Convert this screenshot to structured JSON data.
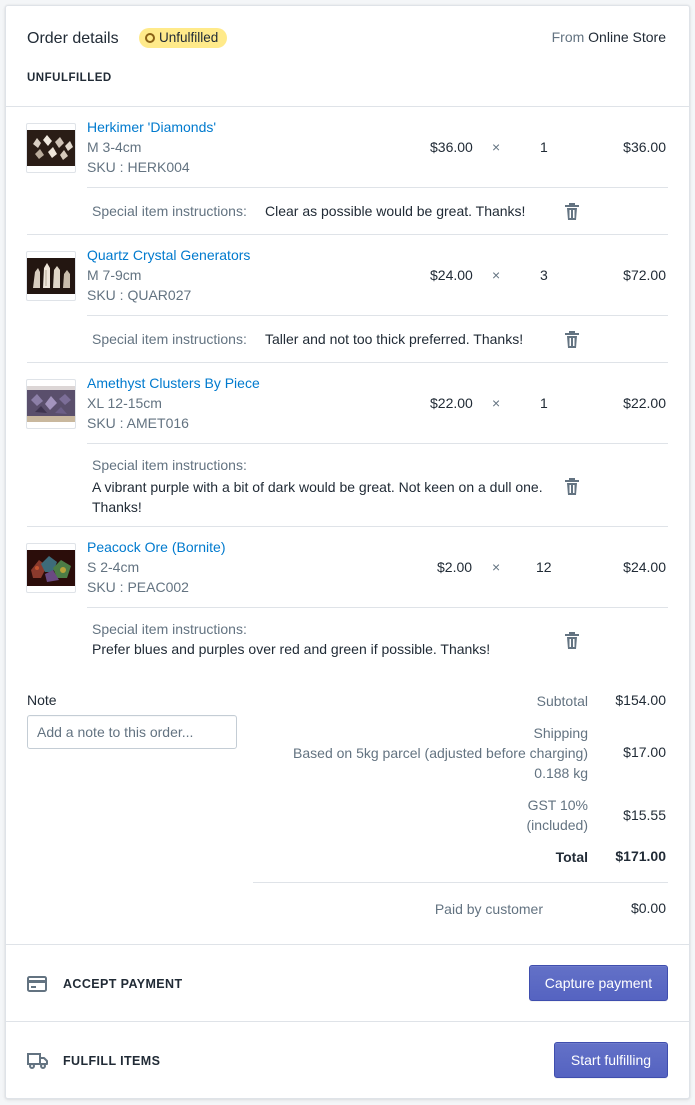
{
  "header": {
    "title": "Order details",
    "status_badge": "Unfulfilled",
    "source_prefix": "From",
    "source_name": "Online Store",
    "section_label": "UNFULFILLED"
  },
  "items": [
    {
      "name": "Herkimer 'Diamonds'",
      "variant": "M 3-4cm",
      "sku": "SKU : HERK004",
      "price": "$36.00",
      "times": "×",
      "qty": "1",
      "total": "$36.00",
      "instructions_label": "Special item instructions:",
      "instructions": "Clear as possible would be great. Thanks!"
    },
    {
      "name": "Quartz Crystal Generators",
      "variant": "M 7-9cm",
      "sku": "SKU : QUAR027",
      "price": "$24.00",
      "times": "×",
      "qty": "3",
      "total": "$72.00",
      "instructions_label": "Special item instructions:",
      "instructions": "Taller and not too thick preferred. Thanks!"
    },
    {
      "name": "Amethyst Clusters By Piece",
      "variant": "XL 12-15cm",
      "sku": "SKU : AMET016",
      "price": "$22.00",
      "times": "×",
      "qty": "1",
      "total": "$22.00",
      "instructions_label": "Special item instructions:",
      "instructions": "A vibrant purple with a bit of dark would be great. Not keen on a dull one. Thanks!"
    },
    {
      "name": "Peacock Ore (Bornite)",
      "variant": "S 2-4cm",
      "sku": "SKU : PEAC002",
      "price": "$2.00",
      "times": "×",
      "qty": "12",
      "total": "$24.00",
      "instructions_label": "Special item instructions:",
      "instructions": "Prefer blues and purples over red and green if possible. Thanks!"
    }
  ],
  "note": {
    "label": "Note",
    "placeholder": "Add a note to this order..."
  },
  "summary": {
    "subtotal_label": "Subtotal",
    "subtotal": "$154.00",
    "shipping_label": "Shipping",
    "shipping_desc": "Based on 5kg parcel (adjusted before charging)",
    "shipping_weight": "0.188 kg",
    "shipping": "$17.00",
    "gst_label": "GST 10%",
    "gst_note": "(included)",
    "gst": "$15.55",
    "total_label": "Total",
    "total": "$171.00",
    "paid_label": "Paid by customer",
    "paid": "$0.00"
  },
  "actions": {
    "payment_label": "ACCEPT PAYMENT",
    "payment_button": "Capture payment",
    "payment_icon": "credit-card-icon",
    "fulfill_label": "FULFILL ITEMS",
    "fulfill_button": "Start fulfilling",
    "fulfill_icon": "truck-icon"
  },
  "colors": {
    "link": "#007ace",
    "badge_bg": "#ffea8a",
    "button": "#5c6ac4"
  }
}
